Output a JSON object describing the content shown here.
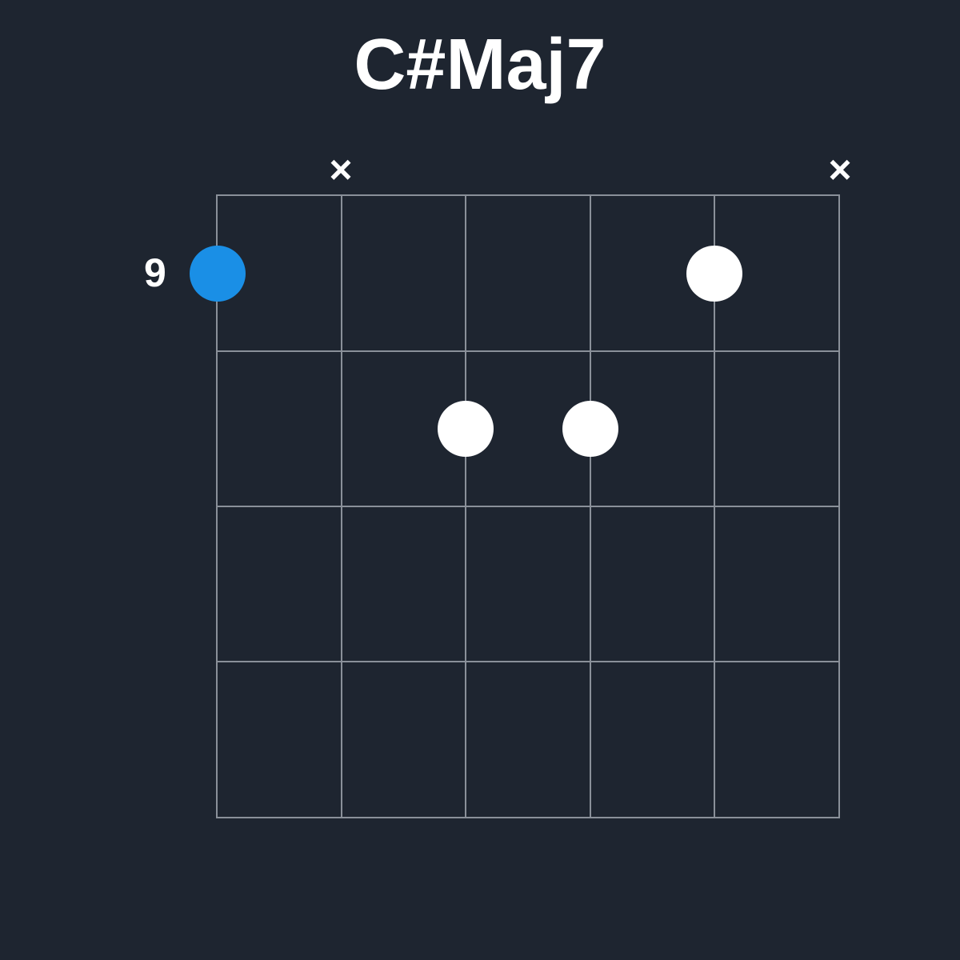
{
  "chord": {
    "name": "C#Maj7",
    "start_fret_label": "9",
    "num_frets_shown": 4,
    "num_strings": 6,
    "string_spacing_pct": 20,
    "fret_spacing_pct": 25,
    "mute_symbol": "×",
    "strings": [
      {
        "index": 0,
        "muted": false
      },
      {
        "index": 1,
        "muted": true
      },
      {
        "index": 2,
        "muted": false
      },
      {
        "index": 3,
        "muted": false
      },
      {
        "index": 4,
        "muted": false
      },
      {
        "index": 5,
        "muted": true
      }
    ],
    "dots": [
      {
        "string": 0,
        "fret": 1,
        "root": true
      },
      {
        "string": 2,
        "fret": 2,
        "root": false
      },
      {
        "string": 3,
        "fret": 2,
        "root": false
      },
      {
        "string": 4,
        "fret": 1,
        "root": false
      }
    ],
    "colors": {
      "background": "#1e2530",
      "grid": "#8a9099",
      "text": "#ffffff",
      "root_dot": "#1a8fe6",
      "dot": "#ffffff"
    }
  }
}
